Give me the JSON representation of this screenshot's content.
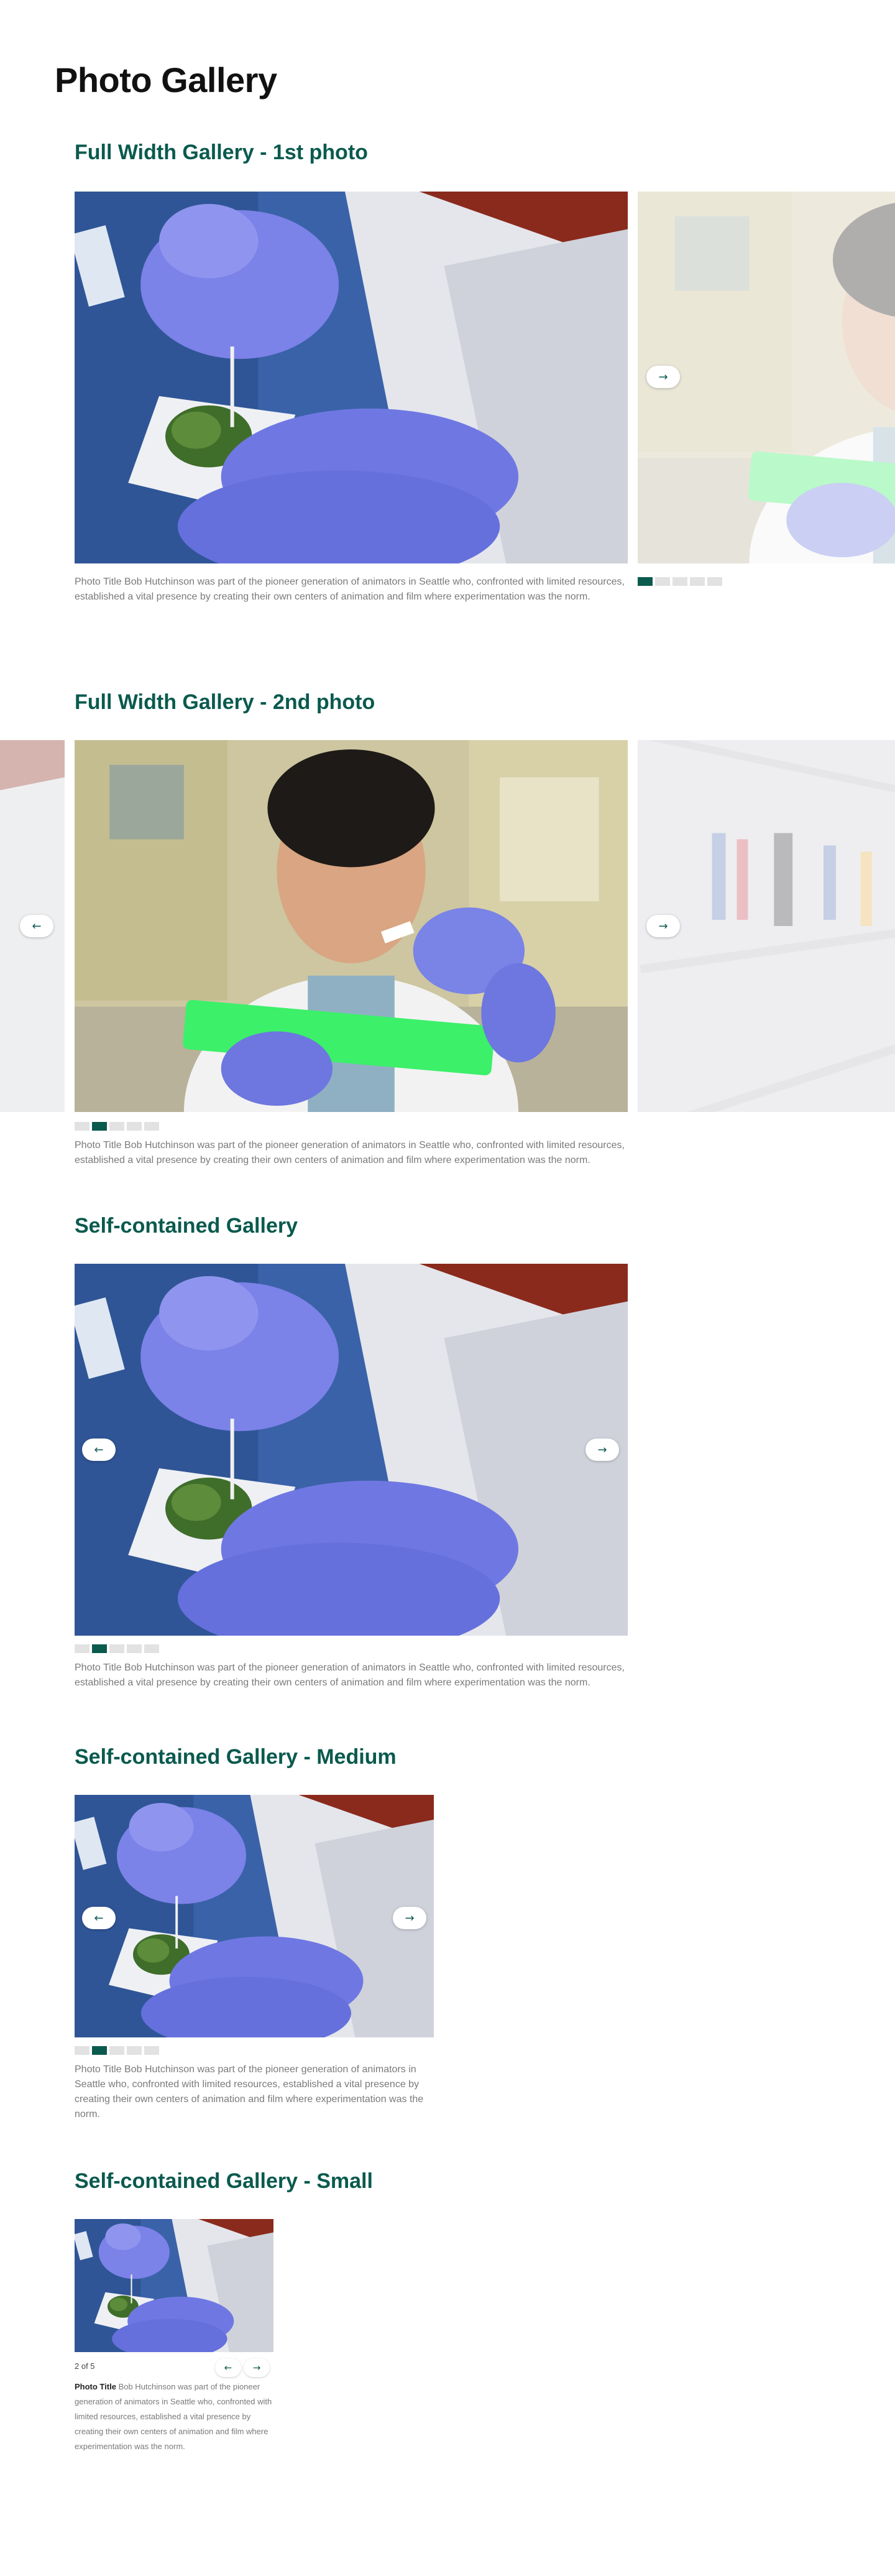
{
  "page": {
    "title": "Photo Gallery"
  },
  "sections": {
    "full1": {
      "title": "Full Width Gallery - 1st photo"
    },
    "full2": {
      "title": "Full Width Gallery - 2nd photo"
    },
    "self": {
      "title": "Self-contained Gallery"
    },
    "medium": {
      "title": "Self-contained Gallery - Medium"
    },
    "small": {
      "title": "Self-contained Gallery - Small"
    }
  },
  "caption": {
    "full": "Photo Title Bob Hutchinson was part of the pioneer generation of animators in Seattle who, confronted with limited resources, established a vital presence by creating their own centers of animation and film where experimentation was the norm.",
    "small_title": "Photo Title",
    "small_body": "Bob Hutchinson was part of the pioneer generation of animators in Seattle who, confronted with limited resources, established a vital presence by creating their own centers of animation and film where experimentation was the norm."
  },
  "small_counter": "2 of 5",
  "icons": {
    "prev": "arrow-left-icon",
    "next": "arrow-right-icon"
  },
  "colors": {
    "accent": "#0a5a4e",
    "dot_inactive": "#e2e2e2",
    "caption": "#7a7a7a"
  }
}
